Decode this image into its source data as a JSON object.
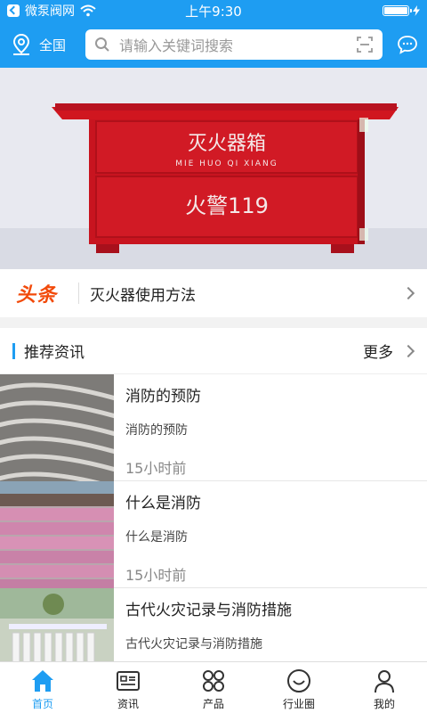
{
  "status_bar": {
    "carrier": "微泵阀网",
    "time": "上午9:30",
    "battery_level": 1.0
  },
  "header": {
    "location_label": "全国",
    "search_placeholder": "请输入关键词搜索"
  },
  "banner": {
    "box_top_text": "灭火器箱",
    "box_top_pinyin": "MIE HUO QI XIANG",
    "box_bottom_text": "火警119"
  },
  "headline": {
    "tag": "头条",
    "text": "灭火器使用方法"
  },
  "recommend": {
    "title": "推荐资讯",
    "more_label": "更多",
    "items": [
      {
        "title": "消防的预防",
        "desc": "消防的预防",
        "time": "15小时前"
      },
      {
        "title": "什么是消防",
        "desc": "什么是消防",
        "time": "15小时前"
      },
      {
        "title": "古代火灾记录与消防措施",
        "desc": "古代火灾记录与消防措施",
        "time": ""
      }
    ]
  },
  "tabbar": {
    "tabs": [
      {
        "label": "首页",
        "icon": "home-icon",
        "active": true
      },
      {
        "label": "资讯",
        "icon": "news-icon",
        "active": false
      },
      {
        "label": "产品",
        "icon": "grid-icon",
        "active": false
      },
      {
        "label": "行业圈",
        "icon": "circle-smile-icon",
        "active": false
      },
      {
        "label": "我的",
        "icon": "user-icon",
        "active": false
      }
    ]
  },
  "colors": {
    "primary": "#1e9df2",
    "headline_tag": "#f24a0a"
  }
}
